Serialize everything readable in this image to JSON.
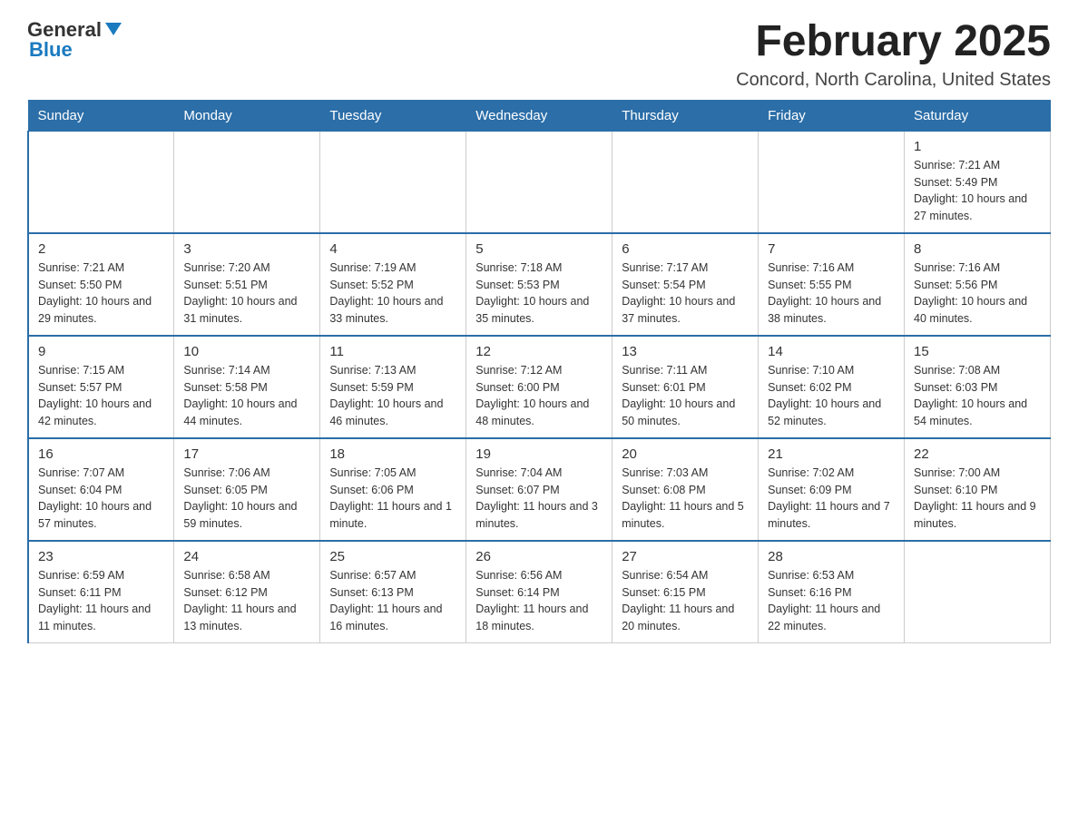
{
  "header": {
    "logo_general": "General",
    "logo_blue": "Blue",
    "month_title": "February 2025",
    "location": "Concord, North Carolina, United States"
  },
  "weekdays": [
    "Sunday",
    "Monday",
    "Tuesday",
    "Wednesday",
    "Thursday",
    "Friday",
    "Saturday"
  ],
  "weeks": [
    [
      {
        "day": "",
        "sunrise": "",
        "sunset": "",
        "daylight": ""
      },
      {
        "day": "",
        "sunrise": "",
        "sunset": "",
        "daylight": ""
      },
      {
        "day": "",
        "sunrise": "",
        "sunset": "",
        "daylight": ""
      },
      {
        "day": "",
        "sunrise": "",
        "sunset": "",
        "daylight": ""
      },
      {
        "day": "",
        "sunrise": "",
        "sunset": "",
        "daylight": ""
      },
      {
        "day": "",
        "sunrise": "",
        "sunset": "",
        "daylight": ""
      },
      {
        "day": "1",
        "sunrise": "Sunrise: 7:21 AM",
        "sunset": "Sunset: 5:49 PM",
        "daylight": "Daylight: 10 hours and 27 minutes."
      }
    ],
    [
      {
        "day": "2",
        "sunrise": "Sunrise: 7:21 AM",
        "sunset": "Sunset: 5:50 PM",
        "daylight": "Daylight: 10 hours and 29 minutes."
      },
      {
        "day": "3",
        "sunrise": "Sunrise: 7:20 AM",
        "sunset": "Sunset: 5:51 PM",
        "daylight": "Daylight: 10 hours and 31 minutes."
      },
      {
        "day": "4",
        "sunrise": "Sunrise: 7:19 AM",
        "sunset": "Sunset: 5:52 PM",
        "daylight": "Daylight: 10 hours and 33 minutes."
      },
      {
        "day": "5",
        "sunrise": "Sunrise: 7:18 AM",
        "sunset": "Sunset: 5:53 PM",
        "daylight": "Daylight: 10 hours and 35 minutes."
      },
      {
        "day": "6",
        "sunrise": "Sunrise: 7:17 AM",
        "sunset": "Sunset: 5:54 PM",
        "daylight": "Daylight: 10 hours and 37 minutes."
      },
      {
        "day": "7",
        "sunrise": "Sunrise: 7:16 AM",
        "sunset": "Sunset: 5:55 PM",
        "daylight": "Daylight: 10 hours and 38 minutes."
      },
      {
        "day": "8",
        "sunrise": "Sunrise: 7:16 AM",
        "sunset": "Sunset: 5:56 PM",
        "daylight": "Daylight: 10 hours and 40 minutes."
      }
    ],
    [
      {
        "day": "9",
        "sunrise": "Sunrise: 7:15 AM",
        "sunset": "Sunset: 5:57 PM",
        "daylight": "Daylight: 10 hours and 42 minutes."
      },
      {
        "day": "10",
        "sunrise": "Sunrise: 7:14 AM",
        "sunset": "Sunset: 5:58 PM",
        "daylight": "Daylight: 10 hours and 44 minutes."
      },
      {
        "day": "11",
        "sunrise": "Sunrise: 7:13 AM",
        "sunset": "Sunset: 5:59 PM",
        "daylight": "Daylight: 10 hours and 46 minutes."
      },
      {
        "day": "12",
        "sunrise": "Sunrise: 7:12 AM",
        "sunset": "Sunset: 6:00 PM",
        "daylight": "Daylight: 10 hours and 48 minutes."
      },
      {
        "day": "13",
        "sunrise": "Sunrise: 7:11 AM",
        "sunset": "Sunset: 6:01 PM",
        "daylight": "Daylight: 10 hours and 50 minutes."
      },
      {
        "day": "14",
        "sunrise": "Sunrise: 7:10 AM",
        "sunset": "Sunset: 6:02 PM",
        "daylight": "Daylight: 10 hours and 52 minutes."
      },
      {
        "day": "15",
        "sunrise": "Sunrise: 7:08 AM",
        "sunset": "Sunset: 6:03 PM",
        "daylight": "Daylight: 10 hours and 54 minutes."
      }
    ],
    [
      {
        "day": "16",
        "sunrise": "Sunrise: 7:07 AM",
        "sunset": "Sunset: 6:04 PM",
        "daylight": "Daylight: 10 hours and 57 minutes."
      },
      {
        "day": "17",
        "sunrise": "Sunrise: 7:06 AM",
        "sunset": "Sunset: 6:05 PM",
        "daylight": "Daylight: 10 hours and 59 minutes."
      },
      {
        "day": "18",
        "sunrise": "Sunrise: 7:05 AM",
        "sunset": "Sunset: 6:06 PM",
        "daylight": "Daylight: 11 hours and 1 minute."
      },
      {
        "day": "19",
        "sunrise": "Sunrise: 7:04 AM",
        "sunset": "Sunset: 6:07 PM",
        "daylight": "Daylight: 11 hours and 3 minutes."
      },
      {
        "day": "20",
        "sunrise": "Sunrise: 7:03 AM",
        "sunset": "Sunset: 6:08 PM",
        "daylight": "Daylight: 11 hours and 5 minutes."
      },
      {
        "day": "21",
        "sunrise": "Sunrise: 7:02 AM",
        "sunset": "Sunset: 6:09 PM",
        "daylight": "Daylight: 11 hours and 7 minutes."
      },
      {
        "day": "22",
        "sunrise": "Sunrise: 7:00 AM",
        "sunset": "Sunset: 6:10 PM",
        "daylight": "Daylight: 11 hours and 9 minutes."
      }
    ],
    [
      {
        "day": "23",
        "sunrise": "Sunrise: 6:59 AM",
        "sunset": "Sunset: 6:11 PM",
        "daylight": "Daylight: 11 hours and 11 minutes."
      },
      {
        "day": "24",
        "sunrise": "Sunrise: 6:58 AM",
        "sunset": "Sunset: 6:12 PM",
        "daylight": "Daylight: 11 hours and 13 minutes."
      },
      {
        "day": "25",
        "sunrise": "Sunrise: 6:57 AM",
        "sunset": "Sunset: 6:13 PM",
        "daylight": "Daylight: 11 hours and 16 minutes."
      },
      {
        "day": "26",
        "sunrise": "Sunrise: 6:56 AM",
        "sunset": "Sunset: 6:14 PM",
        "daylight": "Daylight: 11 hours and 18 minutes."
      },
      {
        "day": "27",
        "sunrise": "Sunrise: 6:54 AM",
        "sunset": "Sunset: 6:15 PM",
        "daylight": "Daylight: 11 hours and 20 minutes."
      },
      {
        "day": "28",
        "sunrise": "Sunrise: 6:53 AM",
        "sunset": "Sunset: 6:16 PM",
        "daylight": "Daylight: 11 hours and 22 minutes."
      },
      {
        "day": "",
        "sunrise": "",
        "sunset": "",
        "daylight": ""
      }
    ]
  ]
}
